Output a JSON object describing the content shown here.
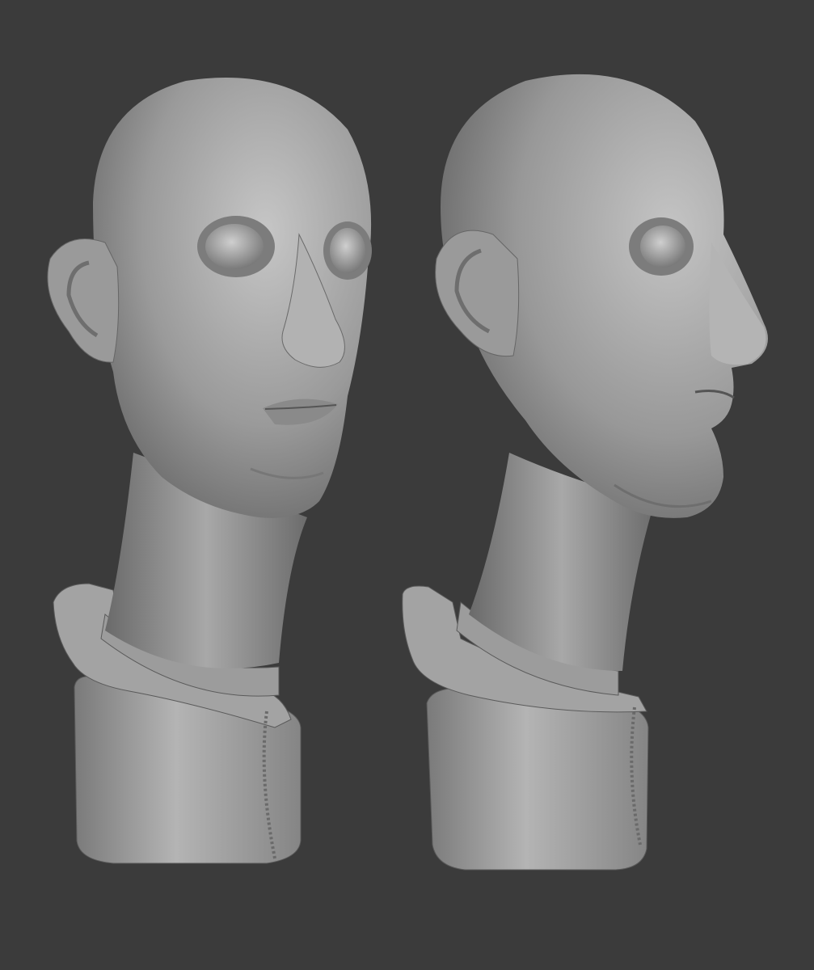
{
  "image": {
    "subject": "two-views-of-sculpted-bust",
    "views": [
      "three-quarter-view",
      "profile-view"
    ]
  },
  "colors": {
    "background": "#3b3b3b",
    "clay_light": "#bdbdbd",
    "clay_mid": "#8f8f8f",
    "clay_dark": "#5c5c5c",
    "shadow": "#2e2e2e"
  }
}
